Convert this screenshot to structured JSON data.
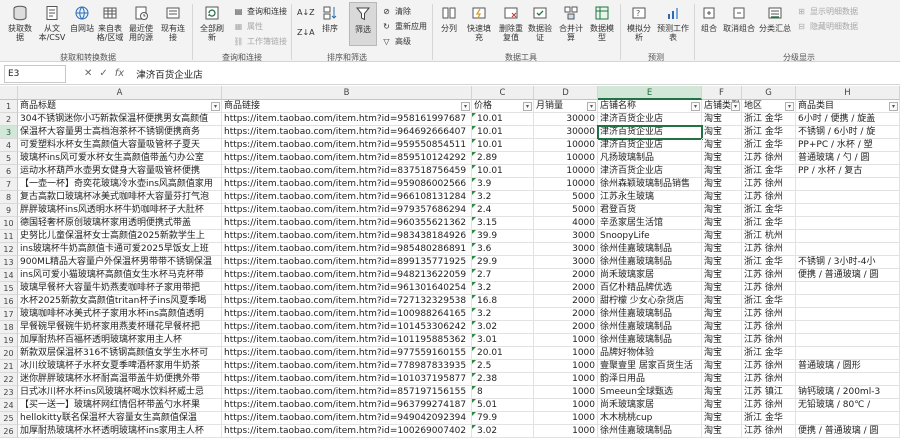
{
  "ribbon": {
    "get_data": "获取数据",
    "from_text_csv": "从文本/CSV",
    "from_web": "自网站",
    "from_table": "来自表格/区域",
    "recent_sources": "最近使用的源",
    "existing_conn": "现有连接",
    "refresh_all": "全部刷新",
    "queries_conn": "查询和连接",
    "properties": "属性",
    "edit_links": "工作簿链接",
    "sort_asc": "A↓Z",
    "sort_desc": "Z↓A",
    "sort": "排序",
    "filter": "筛选",
    "clear": "清除",
    "reapply": "重新应用",
    "advanced": "高级",
    "text_to_col": "分列",
    "flash_fill": "快速填充",
    "remove_dup": "删除重复值",
    "validation": "数据验证",
    "consolidate": "合并计算",
    "data_model": "数据模型",
    "what_if": "模拟分析",
    "forecast_sheet": "预测工作表",
    "group": "组合",
    "ungroup": "取消组合",
    "subtotal": "分类汇总",
    "show_detail": "显示明细数据",
    "hide_detail": "隐藏明细数据",
    "groups": {
      "get_transform": "获取和转换数据",
      "queries": "查询和连接",
      "sort_filter": "排序和筛选",
      "data_tools": "数据工具",
      "forecast": "预测",
      "outline": "分级显示"
    }
  },
  "formula_bar": {
    "name_box": "E3",
    "cancel": "✕",
    "enter": "✓",
    "fx": "fx",
    "value": "津济百货企业店"
  },
  "columns": [
    "A",
    "B",
    "C",
    "D",
    "E",
    "F",
    "G",
    "H"
  ],
  "headers": [
    "商品标题",
    "商品链接",
    "价格",
    "月销量",
    "店铺名称",
    "店铺类型",
    "地区",
    "商品类目"
  ],
  "rows": [
    [
      "304不锈钢迷你小巧新款保温杯便携男女高颜值",
      "https://item.taobao.com/item.htm?id=958161997687",
      "10.01",
      "30000",
      "津济百货企业店",
      "淘宝",
      "浙江 金华",
      "6小时 / 便携 / 旋盖"
    ],
    [
      "保温杯大容量男士高档泡茶杯不锈钢便携商务",
      "https://item.taobao.com/item.htm?id=964692666407",
      "10.01",
      "30000",
      "津济百货企业店",
      "淘宝",
      "浙江 金华",
      "不锈钢 / 6小时 / 旋"
    ],
    [
      "可爱塑料水杯女生高颜值大容量吸管杯子夏天",
      "https://item.taobao.com/item.htm?id=959550854511",
      "10.01",
      "10000",
      "津济百货企业店",
      "淘宝",
      "浙江 金华",
      "PP+PC / 水杯 / 塑"
    ],
    [
      "玻璃杯ins风可爱水杯女生高颜值带盖勺办公室",
      "https://item.taobao.com/item.htm?id=859510124292",
      "2.89",
      "10000",
      "凡扬玻璃制品",
      "淘宝",
      "江苏 徐州",
      "普通玻璃 / 勺 / 圆"
    ],
    [
      "运动水杯葫芦水壶男女健身大容量吸管杯便携",
      "https://item.taobao.com/item.htm?id=837518756459",
      "10.01",
      "10000",
      "津济百货企业店",
      "淘宝",
      "浙江 金华",
      "PP / 水杯 / 复古"
    ],
    [
      "【一壶一杯】奇奕花玻璃冷水壶ins风高颜值家用",
      "https://item.taobao.com/item.htm?id=959086002566",
      "3.9",
      "10000",
      "徐州森颖玻璃制品销售",
      "淘宝",
      "江苏 徐州",
      ""
    ],
    [
      "复古高款口玻璃杯冰美式咖啡杯大容量芬打气泡",
      "https://item.taobao.com/item.htm?id=966108131284",
      "3.2",
      "5000",
      "江苏永生玻璃",
      "淘宝",
      "江苏 徐州",
      ""
    ],
    [
      "胖胖玻璃杯ins风透明水杯牛奶咖啡杯子大肚杯",
      "https://item.taobao.com/item.htm?id=979357686294",
      "2.4",
      "5000",
      "君登百货",
      "淘宝",
      "浙江 金华",
      ""
    ],
    [
      "德国轻奢杯原创玻璃杯家用透明便携式带盖",
      "https://item.taobao.com/item.htm?id=960355621362",
      "3.15",
      "4000",
      "辛丞家居生活馆",
      "淘宝",
      "浙江 金华",
      ""
    ],
    [
      "史努比儿童保温杯女士高颜值2025新款学生上",
      "https://item.taobao.com/item.htm?id=983438184926",
      "39.9",
      "3000",
      "SnoopyLife",
      "淘宝",
      "浙江 杭州",
      ""
    ],
    [
      "ins玻璃杯牛奶高颜值卡通可爱2025早饭女上班",
      "https://item.taobao.com/item.htm?id=985480286891",
      "3.6",
      "3000",
      "徐州佳嘉玻璃制品",
      "淘宝",
      "江苏 徐州",
      ""
    ],
    [
      "900ML精品大容量户外保温杯男带带不锈钢保温",
      "https://item.taobao.com/item.htm?id=899135771925",
      "29.9",
      "3000",
      "徐州佳嘉玻璃制品",
      "淘宝",
      "浙江 金华",
      "不锈钢 / 3小时-4小"
    ],
    [
      "ins风可爱小猫玻璃杯高颜值女生水杯马克杯带",
      "https://item.taobao.com/item.htm?id=948213622059",
      "2.7",
      "2000",
      "尚禾玻璃家居",
      "淘宝",
      "江苏 徐州",
      "便携 / 普通玻璃 / 圆"
    ],
    [
      "玻璃早餐杯大容量牛奶燕麦咖啡杯子家用带把",
      "https://item.taobao.com/item.htm?id=961301640254",
      "3.2",
      "2000",
      "百亿朴精品牌优选",
      "淘宝",
      "江苏 徐州",
      ""
    ],
    [
      "水杯2025新款女高颜值tritan杯子ins风夏季喝",
      "https://item.taobao.com/item.htm?id=727132329538",
      "16.8",
      "2000",
      "甜柠檬 少女心杂货店",
      "淘宝",
      "浙江 金华",
      ""
    ],
    [
      "玻璃咖啡杯冰美式杯子家用水杯ins高颜值透明",
      "https://item.taobao.com/item.htm?id=100988264165",
      "3.2",
      "2000",
      "徐州佳嘉玻璃制品",
      "淘宝",
      "江苏 徐州",
      ""
    ],
    [
      "早餐碗早餐碗牛奶杯家用燕麦杯珊花早餐杯把",
      "https://item.taobao.com/item.htm?id=101453306242",
      "3.02",
      "2000",
      "徐州佳嘉玻璃制品",
      "淘宝",
      "江苏 徐州",
      ""
    ],
    [
      "加厚耐热杯百福杯透明玻璃杯家用主人杯",
      "https://item.taobao.com/item.htm?id=101195885362",
      "3.01",
      "1000",
      "徐州佳嘉玻璃制品",
      "淘宝",
      "江苏 徐州",
      ""
    ],
    [
      "新款双层保温杯316不锈钢高颜值女学生水杯可",
      "https://item.taobao.com/item.htm?id=977559160155",
      "20.01",
      "1000",
      "品牌好物体验",
      "淘宝",
      "浙江 金华",
      ""
    ],
    [
      "冰川纹玻璃杯子水杯女夏季啤酒杯家用牛奶茶",
      "https://item.taobao.com/item.htm?id=778987833935",
      "2.5",
      "1000",
      "壹聚壹里 居家百货生活",
      "淘宝",
      "江苏 徐州",
      "普通玻璃 / 圆形"
    ],
    [
      "迷你胖胖玻璃杯水杯耐高温带盖牛奶便携外带",
      "https://item.taobao.com/item.htm?id=101037195877",
      "2.38",
      "1000",
      "韵泽日用品",
      "淘宝",
      "江苏 徐州",
      ""
    ],
    [
      "日式冰川杯水杯ins风玻璃杯喝水饮料杯威士忌",
      "https://item.taobao.com/item.htm?id=857197156155",
      "8",
      "1000",
      "Smeeun全球甄选",
      "淘宝",
      "江苏 镇江",
      "钠钙玻璃 / 200ml-3"
    ],
    [
      "【买一送一】玻璃杯网红情侣杯带盖勺水杯果",
      "https://item.taobao.com/item.htm?id=963799274187",
      "5.01",
      "1000",
      "尚禾玻璃家居",
      "淘宝",
      "江苏 徐州",
      "无铅玻璃 / 80℃ /"
    ],
    [
      "hellokitty联名保温杯大容量女生高颜值保温",
      "https://item.taobao.com/item.htm?id=949042092394",
      "79.9",
      "1000",
      "木木桃桃cup",
      "淘宝",
      "浙江 金华",
      ""
    ],
    [
      "加厚耐热玻璃杯水杯透明玻璃杯ins家用主人杯",
      "https://item.taobao.com/item.htm?id=100269007402",
      "3.02",
      "1000",
      "徐州佳嘉玻璃制品",
      "淘宝",
      "江苏 徐州",
      "便携 / 普通玻璃 / 圆"
    ]
  ]
}
